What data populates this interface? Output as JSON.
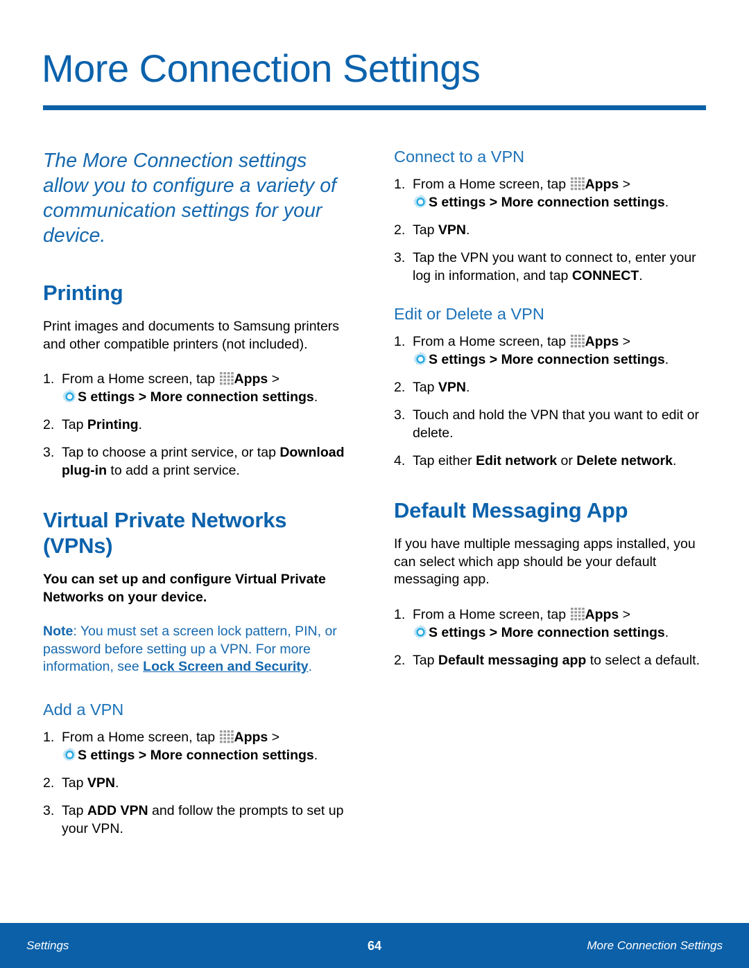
{
  "page": {
    "title": "More Connection Settings",
    "intro": "The More Connection settings allow you to configure a variety of communication settings for your device."
  },
  "icons": {
    "apps": "apps-grid-icon",
    "settings_gear": "settings-gear-icon"
  },
  "colors": {
    "heading_blue": "#0B62AC",
    "subheading_blue": "#1C72B8",
    "note_blue": "#1568AE",
    "rule_blue": "#0B60A8",
    "footer_blue": "#0B60A8",
    "body_black": "#000000",
    "gear_cyan": "#29ABE2",
    "apps_gray": "#9B9B9B"
  },
  "left_column": {
    "printing": {
      "heading": "Printing",
      "body": "Print images and documents to Samsung printers and other compatible printers (not included).",
      "steps": [
        {
          "num": "1.",
          "pre": "From a Home screen, tap ",
          "apps_label": "Apps",
          "mid": " > ",
          "settings_label": "S ettings > More connection settings",
          "post": "."
        },
        {
          "num": "2.",
          "pre": "Tap ",
          "bold": "Printing",
          "post": "."
        },
        {
          "num": "3.",
          "pre": "Tap to choose a print service, or tap ",
          "bold": "Download plug-in",
          "post": " to add a print service."
        }
      ]
    },
    "vpns": {
      "heading": "Virtual Private Networks (VPNs)",
      "body": "You can set up and configure Virtual Private Networks on your device.",
      "note_label": "Note",
      "note_text": ": You must set a screen lock pattern, PIN, or password before setting up a VPN. For more information, see ",
      "note_link": "Lock Screen and Security",
      "note_tail": "."
    },
    "add_vpn": {
      "heading": "Add a VPN",
      "steps": [
        {
          "num": "1.",
          "pre": "From a Home screen, tap ",
          "apps_label": "Apps",
          "mid": " > ",
          "settings_label": "S ettings > More connection settings",
          "post": "."
        },
        {
          "num": "2.",
          "pre": "Tap ",
          "bold": "VPN",
          "post": "."
        },
        {
          "num": "3.",
          "pre": "Tap ",
          "bold": "ADD VPN",
          "post": " and follow the prompts to set up your VPN."
        }
      ]
    }
  },
  "right_column": {
    "connect_vpn": {
      "heading": "Connect to a VPN",
      "steps": [
        {
          "num": "1.",
          "pre": "From a Home screen, tap ",
          "apps_label": "Apps",
          "mid": " > ",
          "settings_label": "S ettings > More connection settings",
          "post": "."
        },
        {
          "num": "2.",
          "pre": "Tap ",
          "bold": "VPN",
          "post": "."
        },
        {
          "num": "3.",
          "pre": "Tap the VPN you want to connect to, enter your log in information, and tap ",
          "bold": "CONNECT",
          "post": "."
        }
      ]
    },
    "edit_delete_vpn": {
      "heading": "Edit or Delete a VPN",
      "steps": [
        {
          "num": "1.",
          "pre": "From a Home screen, tap ",
          "apps_label": "Apps",
          "mid": " > ",
          "settings_label": "S ettings > More connection settings",
          "post": "."
        },
        {
          "num": "2.",
          "pre": "Tap ",
          "bold": "VPN",
          "post": "."
        },
        {
          "num": "3.",
          "pre": "Touch and hold the VPN that you want to edit or delete.",
          "bold": "",
          "post": ""
        },
        {
          "num": "4.",
          "pre": "Tap either ",
          "bold": "Edit network",
          "mid": " or ",
          "bold2": "Delete network",
          "post": "."
        }
      ]
    },
    "default_messaging": {
      "heading": "Default Messaging App",
      "body": "If you have multiple messaging apps installed, you can select which app should be your default messaging app.",
      "steps": [
        {
          "num": "1.",
          "pre": "From a Home screen, tap ",
          "apps_label": "Apps",
          "mid": " > ",
          "settings_label": "S ettings > More connection settings",
          "post": "."
        },
        {
          "num": "2.",
          "pre": "Tap ",
          "bold": "Default messaging app",
          "post": " to select a default."
        }
      ]
    }
  },
  "footer": {
    "left": "Settings",
    "page_number": "64",
    "right": "More Connection Settings"
  }
}
